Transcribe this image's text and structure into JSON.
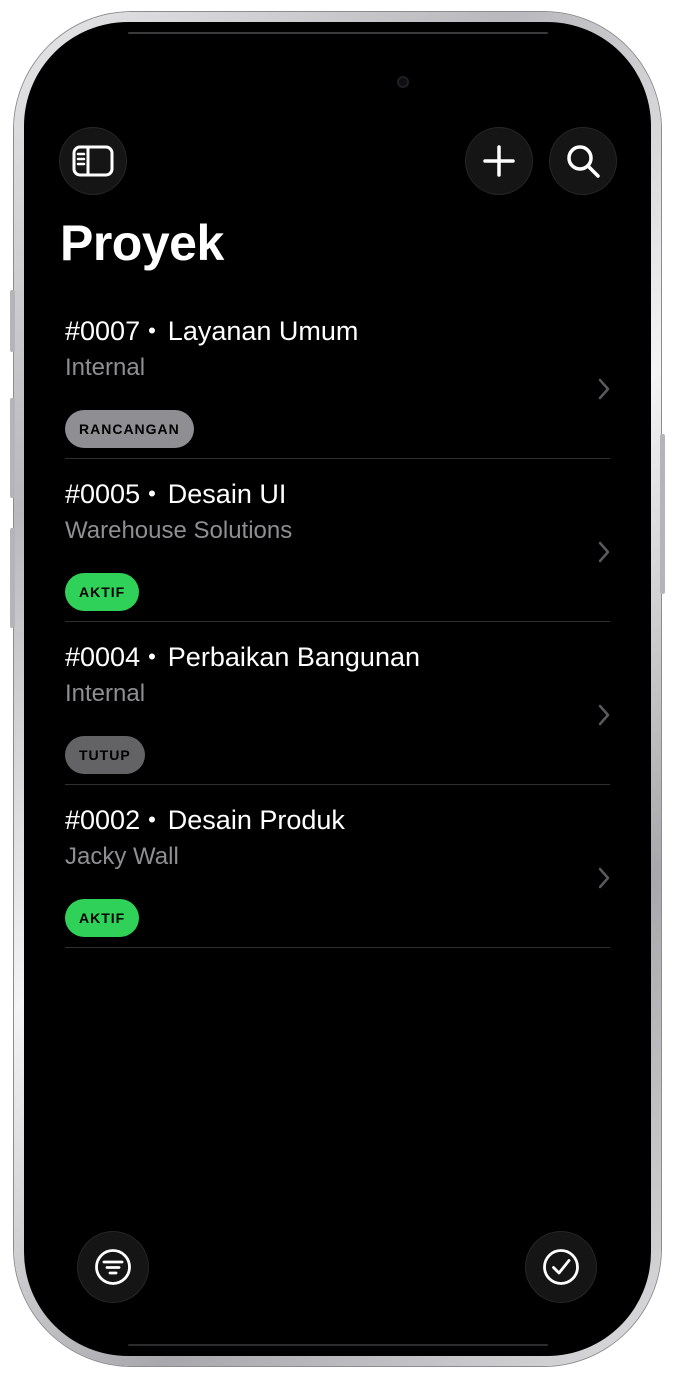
{
  "title": "Proyek",
  "projects": [
    {
      "number": "#0007",
      "name": "Layanan Umum",
      "client": "Internal",
      "status": "RANCANGAN",
      "status_color": "#8e8e93"
    },
    {
      "number": "#0005",
      "name": "Desain UI",
      "client": "Warehouse Solutions",
      "status": "AKTIF",
      "status_color": "#30d158"
    },
    {
      "number": "#0004",
      "name": "Perbaikan Bangunan",
      "client": "Internal",
      "status": "TUTUP",
      "status_color": "#636366"
    },
    {
      "number": "#0002",
      "name": "Desain Produk",
      "client": "Jacky Wall",
      "status": "AKTIF",
      "status_color": "#30d158"
    }
  ],
  "icons": {
    "sidebar": "sidebar-icon",
    "add": "plus-icon",
    "search": "search-icon",
    "filter": "filter-icon",
    "select": "checkmark-circle-icon",
    "chevron": "chevron-right-icon"
  }
}
